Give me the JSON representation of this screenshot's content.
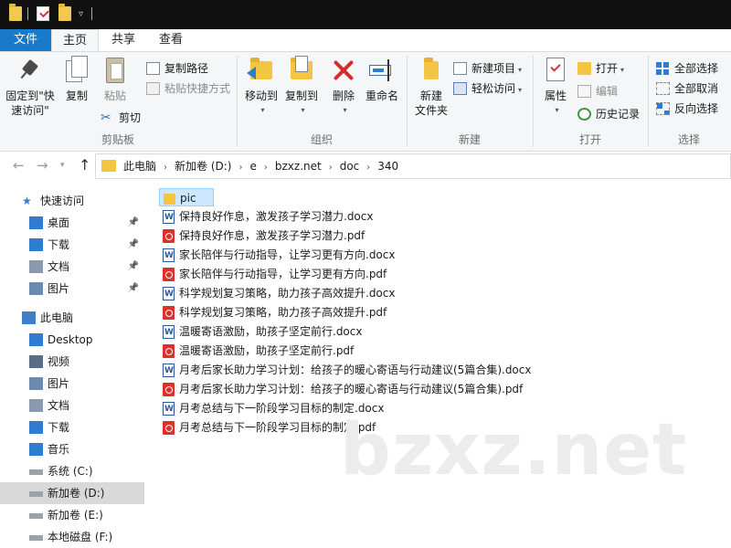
{
  "titlebar": {
    "quick_access_icons": [
      "folder-icon",
      "properties-icon",
      "new-folder-icon"
    ],
    "dropdown_glyph": "▿"
  },
  "tabs": {
    "file": "文件",
    "home": "主页",
    "share": "共享",
    "view": "查看"
  },
  "ribbon": {
    "clipboard": {
      "pin_label": "固定到\"快\n速访问\"",
      "copy_label": "复制",
      "paste_label": "粘贴",
      "copy_path_label": "复制路径",
      "paste_shortcut_label": "粘贴快捷方式",
      "cut_label": "剪切",
      "group_label": "剪贴板"
    },
    "organize": {
      "move_to_label": "移动到",
      "copy_to_label": "复制到",
      "delete_label": "删除",
      "rename_label": "重命名",
      "group_label": "组织"
    },
    "new": {
      "new_folder_label": "新建\n文件夹",
      "new_item_label": "新建项目",
      "easy_access_label": "轻松访问",
      "group_label": "新建"
    },
    "open": {
      "properties_label": "属性",
      "open_label": "打开",
      "edit_label": "编辑",
      "history_label": "历史记录",
      "group_label": "打开"
    },
    "select": {
      "select_all_label": "全部选择",
      "select_none_label": "全部取消",
      "invert_label": "反向选择",
      "group_label": "选择"
    }
  },
  "address": {
    "crumbs": [
      "此电脑",
      "新加卷 (D:)",
      "e",
      "bzxz.net",
      "doc",
      "340"
    ]
  },
  "nav": {
    "quick_access": "快速访问",
    "items": [
      {
        "label": "桌面",
        "icon": "desktop-icon",
        "pinned": true
      },
      {
        "label": "下载",
        "icon": "download-icon",
        "pinned": true
      },
      {
        "label": "文档",
        "icon": "documents-icon",
        "pinned": true
      },
      {
        "label": "图片",
        "icon": "pictures-icon",
        "pinned": true
      }
    ],
    "this_pc": "此电脑",
    "pc_items": [
      {
        "label": "Desktop",
        "icon": "desktop-icon"
      },
      {
        "label": "视频",
        "icon": "videos-icon"
      },
      {
        "label": "图片",
        "icon": "pictures-icon"
      },
      {
        "label": "文档",
        "icon": "documents-icon"
      },
      {
        "label": "下载",
        "icon": "download-icon"
      },
      {
        "label": "音乐",
        "icon": "music-icon"
      },
      {
        "label": "系统 (C:)",
        "icon": "drive-icon"
      },
      {
        "label": "新加卷 (D:)",
        "icon": "drive-icon",
        "selected": true
      },
      {
        "label": "新加卷 (E:)",
        "icon": "drive-icon"
      },
      {
        "label": "本地磁盘 (F:)",
        "icon": "drive-icon"
      }
    ]
  },
  "files": [
    {
      "name": "pic",
      "type": "folder"
    },
    {
      "name": "保持良好作息，激发孩子学习潜力.docx",
      "type": "docx"
    },
    {
      "name": "保持良好作息，激发孩子学习潜力.pdf",
      "type": "pdf"
    },
    {
      "name": "家长陪伴与行动指导，让学习更有方向.docx",
      "type": "docx"
    },
    {
      "name": "家长陪伴与行动指导，让学习更有方向.pdf",
      "type": "pdf"
    },
    {
      "name": "科学规划复习策略，助力孩子高效提升.docx",
      "type": "docx"
    },
    {
      "name": "科学规划复习策略，助力孩子高效提升.pdf",
      "type": "pdf"
    },
    {
      "name": "温暖寄语激励，助孩子坚定前行.docx",
      "type": "docx"
    },
    {
      "name": "温暖寄语激励，助孩子坚定前行.pdf",
      "type": "pdf"
    },
    {
      "name": "月考后家长助力学习计划：给孩子的暖心寄语与行动建议(5篇合集).docx",
      "type": "docx"
    },
    {
      "name": "月考后家长助力学习计划：给孩子的暖心寄语与行动建议(5篇合集).pdf",
      "type": "pdf"
    },
    {
      "name": "月考总结与下一阶段学习目标的制定.docx",
      "type": "docx"
    },
    {
      "name": "月考总结与下一阶段学习目标的制定.pdf",
      "type": "pdf"
    }
  ],
  "watermark": "bzxz.net",
  "colors": {
    "file_tab": "#1979ca",
    "selection": "#cce8ff",
    "nav_selected": "#d9d9d9"
  }
}
